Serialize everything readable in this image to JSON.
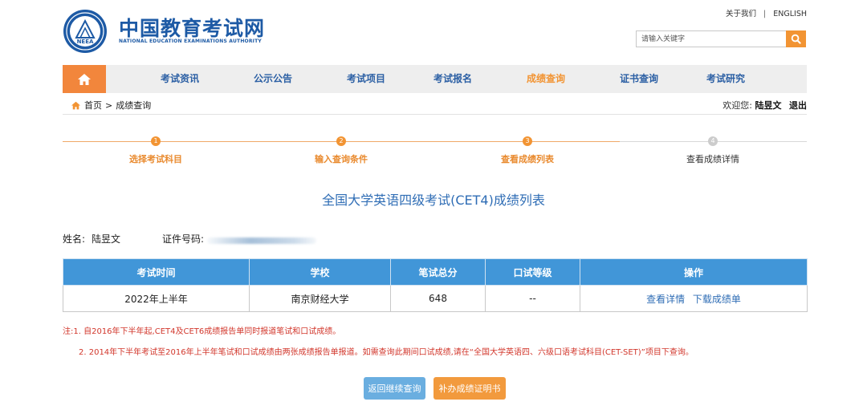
{
  "header": {
    "site_name": "中国教育考试网",
    "site_name_en": "NATIONAL EDUCATION EXAMINATIONS AUTHORITY",
    "logo_text": "NEEA",
    "about_label": "关于我们",
    "separator": "|",
    "english_label": "ENGLISH",
    "search_placeholder": "请输入关键字"
  },
  "nav": {
    "items": [
      {
        "label": "考试资讯"
      },
      {
        "label": "公示公告"
      },
      {
        "label": "考试项目"
      },
      {
        "label": "考试报名"
      },
      {
        "label": "成绩查询",
        "active": true
      },
      {
        "label": "证书查询"
      },
      {
        "label": "考试研究"
      }
    ]
  },
  "breadcrumb": {
    "home_label": "首页",
    "separator": ">",
    "current": "成绩查询"
  },
  "user": {
    "welcome_label": "欢迎您:",
    "name": "陆昱文",
    "logout_label": "退出"
  },
  "steps": [
    {
      "num": "1",
      "label": "选择考试科目",
      "done": true
    },
    {
      "num": "2",
      "label": "输入查询条件",
      "done": true
    },
    {
      "num": "3",
      "label": "查看成绩列表",
      "done": true
    },
    {
      "num": "4",
      "label": "查看成绩详情",
      "done": false
    }
  ],
  "result_title": "全国大学英语四级考试(CET4)成绩列表",
  "candidate": {
    "name_label": "姓名:",
    "name": "陆昱文",
    "id_label": "证件号码:"
  },
  "table": {
    "headers": [
      "考试时间",
      "学校",
      "笔试总分",
      "口试等级",
      "操作"
    ],
    "rows": [
      {
        "exam_time": "2022年上半年",
        "school": "南京财经大学",
        "written_total": "648",
        "oral_grade": "--",
        "action_detail": "查看详情",
        "action_download": "下载成绩单"
      }
    ]
  },
  "notes": {
    "line1": "注:1. 自2016年下半年起,CET4及CET6成绩报告单同时报道笔试和口试成绩。",
    "line2": "2. 2014年下半年考试至2016年上半年笔试和口试成绩由两张成绩报告单报道。如需查询此期间口试成绩,请在“全国大学英语四、六级口语考试科目(CET-SET)”项目下查询。"
  },
  "buttons": {
    "back_label": "返回继续查询",
    "certificate_label": "补办成绩证明书"
  },
  "colors": {
    "brand_blue": "#1d5aa5",
    "accent_orange": "#f29433",
    "table_header_blue": "#4196d8",
    "note_red": "#d2372c"
  }
}
